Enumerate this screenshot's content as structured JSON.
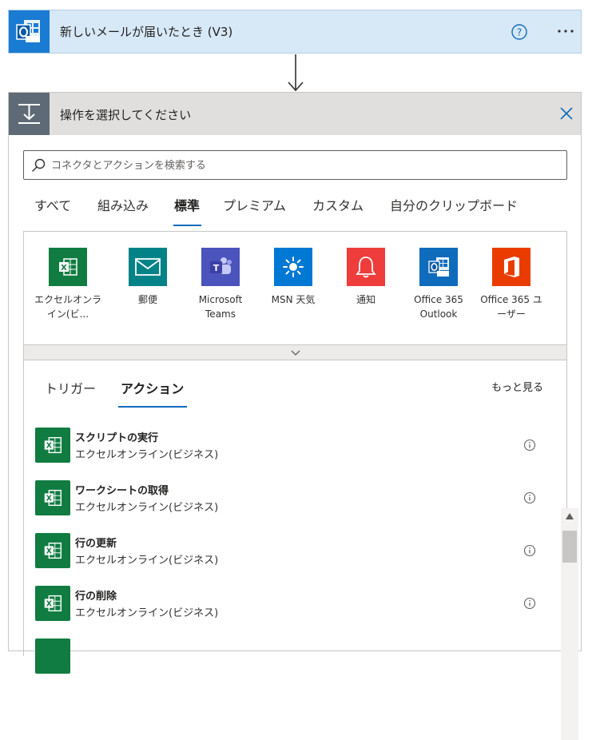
{
  "trigger": {
    "title": "新しいメールが届いたとき (V3)",
    "icon": "outlook-icon"
  },
  "panel": {
    "title": "操作を選択してください",
    "icon": "action-icon"
  },
  "search": {
    "placeholder": "コネクタとアクションを検索する"
  },
  "tabs": [
    {
      "label": "すべて",
      "active": false
    },
    {
      "label": "組み込み",
      "active": false
    },
    {
      "label": "標準",
      "active": true
    },
    {
      "label": "プレミアム",
      "active": false
    },
    {
      "label": "カスタム",
      "active": false
    },
    {
      "label": "自分のクリップボード",
      "active": false
    }
  ],
  "connectors": [
    {
      "label": "エクセルオンライン(ビ...",
      "icon": "excel-icon",
      "color": "#107c41"
    },
    {
      "label": "郵便",
      "icon": "mail-icon",
      "color": "#038387"
    },
    {
      "label": "Microsoft Teams",
      "icon": "teams-icon",
      "color": "#4b53bc"
    },
    {
      "label": "MSN 天気",
      "icon": "sun-icon",
      "color": "#0078d4"
    },
    {
      "label": "通知",
      "icon": "bell-icon",
      "color": "#ee3d3a"
    },
    {
      "label": "Office 365 Outlook",
      "icon": "outlook-icon",
      "color": "#0f6cbd"
    },
    {
      "label": "Office 365 ユーザー",
      "icon": "office-icon",
      "color": "#eb3c00"
    }
  ],
  "subtabs": [
    {
      "label": "トリガー",
      "active": false
    },
    {
      "label": "アクション",
      "active": true
    }
  ],
  "more_link": "もっと見る",
  "actions": [
    {
      "title": "スクリプトの実行",
      "subtitle": "エクセルオンライン(ビジネス)"
    },
    {
      "title": "ワークシートの取得",
      "subtitle": "エクセルオンライン(ビジネス)"
    },
    {
      "title": "行の更新",
      "subtitle": "エクセルオンライン(ビジネス)"
    },
    {
      "title": "行の削除",
      "subtitle": "エクセルオンライン(ビジネス)"
    }
  ],
  "colors": {
    "accent": "#0f6cbd",
    "trigger_bg": "#d7e8f7",
    "header_bg": "#e1dfdd",
    "excel": "#107c41"
  }
}
